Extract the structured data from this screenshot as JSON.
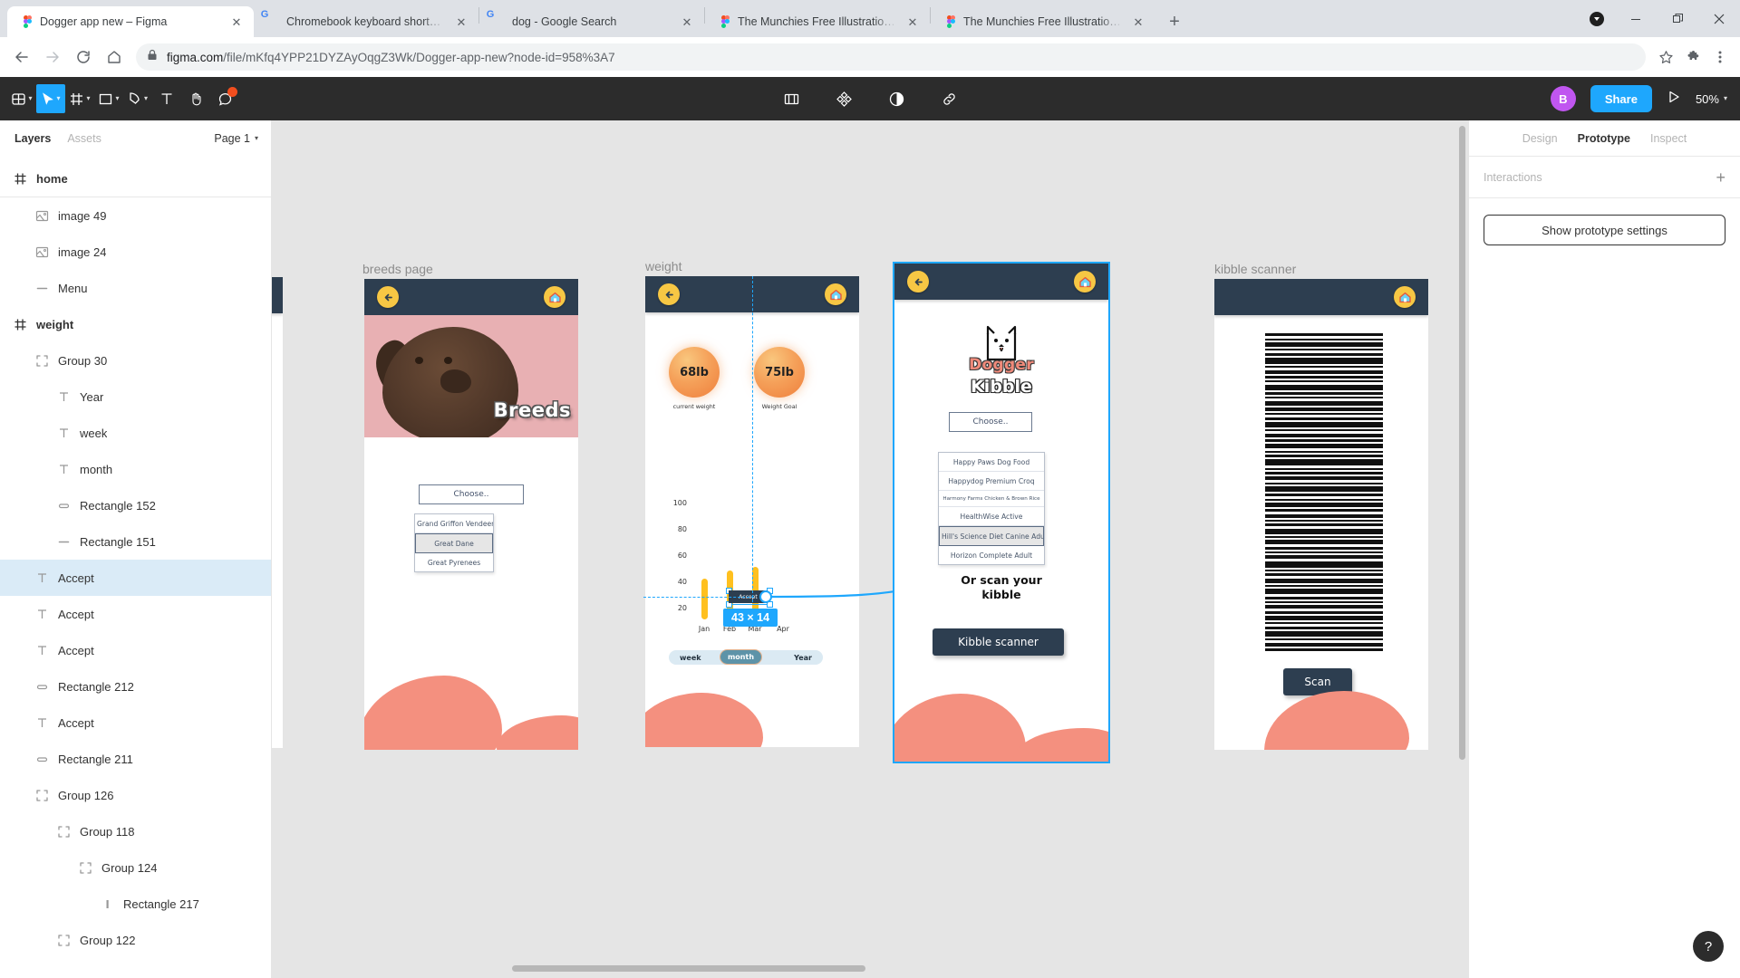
{
  "browser": {
    "tabs": [
      {
        "title": "Dogger app new – Figma",
        "favicon": "figma-icon",
        "active": true
      },
      {
        "title": "Chromebook keyboard shortcuts",
        "favicon": "google-icon",
        "active": false
      },
      {
        "title": "dog - Google Search",
        "favicon": "google-icon",
        "active": false
      },
      {
        "title": "The Munchies Free Illustrations -",
        "favicon": "figma-icon",
        "active": false
      },
      {
        "title": "The Munchies Free Illustrations (",
        "favicon": "figma-icon",
        "active": false
      }
    ],
    "new_tab_label": "+",
    "close_label": "✕",
    "window_controls": {
      "minimize": "—",
      "maximize": "❐",
      "close": "✕"
    },
    "url": {
      "host": "figma.com",
      "path": "/file/mKfq4YPP21DYZAyOqgZ3Wk/Dogger-app-new?node-id=958%3A7",
      "lock_icon": "lock-icon"
    },
    "omni_icons": {
      "back": "back-arrow-icon",
      "forward": "forward-arrow-icon",
      "reload": "reload-icon",
      "home": "home-icon",
      "bookmark": "star-icon",
      "extensions": "puzzle-piece-icon",
      "menu": "three-dot-menu-icon",
      "profile": "profile-avatar-icon"
    }
  },
  "figma_toolbar": {
    "left_tools": [
      {
        "name": "main-menu",
        "icon": "figma-logo-icon",
        "has_caret": true,
        "active": false
      },
      {
        "name": "move-tool",
        "icon": "cursor-arrow-icon",
        "has_caret": true,
        "active": true
      },
      {
        "name": "frame-tool",
        "icon": "frame-icon",
        "has_caret": true,
        "active": false
      },
      {
        "name": "shape-tool",
        "icon": "rectangle-icon",
        "has_caret": true,
        "active": false
      },
      {
        "name": "pen-tool",
        "icon": "pen-icon",
        "has_caret": true,
        "active": false
      },
      {
        "name": "text-tool",
        "icon": "text-t-icon",
        "has_caret": false,
        "active": false
      },
      {
        "name": "hand-tool",
        "icon": "hand-icon",
        "has_caret": false,
        "active": false
      },
      {
        "name": "comment-tool",
        "icon": "comment-bubble-icon",
        "has_caret": false,
        "active": false
      }
    ],
    "center_tools": [
      {
        "name": "components",
        "icon": "component-icon"
      },
      {
        "name": "plugins",
        "icon": "plugin-grid-icon"
      },
      {
        "name": "contrast",
        "icon": "contrast-circle-icon"
      },
      {
        "name": "link",
        "icon": "link-chain-icon"
      }
    ],
    "avatar_initial": "B",
    "share_label": "Share",
    "present_icon": "play-triangle-icon",
    "zoom_level": "50%",
    "zoom_caret": "▾"
  },
  "left_panel": {
    "tabs": [
      {
        "label": "Layers",
        "active": true
      },
      {
        "label": "Assets",
        "active": false
      }
    ],
    "page_selector": "Page 1",
    "page_caret": "▾",
    "layers": [
      {
        "name": "home",
        "icon": "frame-hash-icon",
        "indent": 0,
        "bold": true,
        "selected": false
      },
      {
        "name": "image 49",
        "icon": "image-icon",
        "indent": 1,
        "bold": false,
        "selected": false
      },
      {
        "name": "image 24",
        "icon": "image-icon",
        "indent": 1,
        "bold": false,
        "selected": false
      },
      {
        "name": "Menu",
        "icon": "line-icon",
        "indent": 1,
        "bold": false,
        "selected": false
      },
      {
        "name": "weight",
        "icon": "frame-hash-icon",
        "indent": 0,
        "bold": true,
        "selected": false
      },
      {
        "name": "Group 30",
        "icon": "group-icon",
        "indent": 1,
        "bold": false,
        "selected": false
      },
      {
        "name": "Year",
        "icon": "text-layer-icon",
        "indent": 2,
        "bold": false,
        "selected": false
      },
      {
        "name": "week",
        "icon": "text-layer-icon",
        "indent": 2,
        "bold": false,
        "selected": false
      },
      {
        "name": "month",
        "icon": "text-layer-icon",
        "indent": 2,
        "bold": false,
        "selected": false
      },
      {
        "name": "Rectangle 152",
        "icon": "rounded-rect-icon",
        "indent": 2,
        "bold": false,
        "selected": false
      },
      {
        "name": "Rectangle 151",
        "icon": "line-icon",
        "indent": 2,
        "bold": false,
        "selected": false
      },
      {
        "name": "Accept",
        "icon": "text-layer-icon",
        "indent": 1,
        "bold": false,
        "selected": true
      },
      {
        "name": "Accept",
        "icon": "text-layer-icon",
        "indent": 1,
        "bold": false,
        "selected": false
      },
      {
        "name": "Accept",
        "icon": "text-layer-icon",
        "indent": 1,
        "bold": false,
        "selected": false
      },
      {
        "name": "Rectangle 212",
        "icon": "rounded-rect-icon",
        "indent": 1,
        "bold": false,
        "selected": false
      },
      {
        "name": "Accept",
        "icon": "text-layer-icon",
        "indent": 1,
        "bold": false,
        "selected": false
      },
      {
        "name": "Rectangle 211",
        "icon": "rounded-rect-icon",
        "indent": 1,
        "bold": false,
        "selected": false
      },
      {
        "name": "Group 126",
        "icon": "group-icon",
        "indent": 1,
        "bold": false,
        "selected": false
      },
      {
        "name": "Group 118",
        "icon": "group-icon",
        "indent": 2,
        "bold": false,
        "selected": false
      },
      {
        "name": "Group 124",
        "icon": "group-icon",
        "indent": 3,
        "bold": false,
        "selected": false
      },
      {
        "name": "Rectangle 217",
        "icon": "vbar-icon",
        "indent": 4,
        "bold": false,
        "selected": false
      },
      {
        "name": "Group 122",
        "icon": "group-icon",
        "indent": 2,
        "bold": false,
        "selected": false
      }
    ]
  },
  "right_panel": {
    "tabs": [
      {
        "label": "Design",
        "active": false
      },
      {
        "label": "Prototype",
        "active": true
      },
      {
        "label": "Inspect",
        "active": false
      }
    ],
    "interactions_label": "Interactions",
    "add_interaction_icon": "plus-icon",
    "show_prototype_settings_label": "Show prototype settings",
    "help_label": "?"
  },
  "canvas": {
    "selection_size_badge": "43 × 14",
    "back_hotspot_icon": "back-flow-arrow-icon",
    "frames": [
      {
        "id": "breeds-page",
        "label": "breeds page",
        "topbar": {
          "back_icon": "back-arrow-circle-icon",
          "home_icon": "home-circle-icon"
        },
        "hero_caption": "Breeds",
        "choose_label": "Choose..",
        "options": [
          {
            "label": "Grand Griffon Vendeen",
            "selected": false
          },
          {
            "label": "Great Dane",
            "selected": true
          },
          {
            "label": "Great Pyrenees",
            "selected": false
          }
        ]
      },
      {
        "id": "weight",
        "label": "weight",
        "topbar": {
          "back_icon": "back-arrow-circle-icon",
          "home_icon": "home-circle-icon"
        },
        "metrics": [
          {
            "value": "68lb",
            "caption": "current weight"
          },
          {
            "value": "75lb",
            "caption": "Weight Goal"
          }
        ],
        "segments": [
          {
            "label": "week",
            "active": false
          },
          {
            "label": "month",
            "active": true
          },
          {
            "label": "Year",
            "active": false
          }
        ]
      },
      {
        "id": "kibble",
        "label": "",
        "topbar": {
          "back_icon": "back-arrow-circle-icon",
          "home_icon": "home-circle-icon"
        },
        "logo_word": "Dogger",
        "logo_sub": "Kibble",
        "choose_label": "Choose..",
        "options": [
          {
            "label": "Happy Paws Dog Food",
            "selected": false,
            "tiny": false
          },
          {
            "label": "Happydog Premium Croq",
            "selected": false,
            "tiny": false
          },
          {
            "label": "Harmony Farms Chicken & Brown Rice",
            "selected": false,
            "tiny": true
          },
          {
            "label": "HealthWise Active",
            "selected": false,
            "tiny": false
          },
          {
            "label": "Hill's Science Diet Canine Adult",
            "selected": true,
            "tiny": false
          },
          {
            "label": "Horizon Complete Adult",
            "selected": false,
            "tiny": false
          }
        ],
        "scan_heading_line1": "Or scan your",
        "scan_heading_line2": "kibble",
        "scanner_button": "Kibble scanner"
      },
      {
        "id": "kibble-scanner",
        "label": "kibble scanner",
        "topbar": {
          "home_icon": "home-circle-icon"
        },
        "scan_button": "Scan"
      }
    ],
    "chart_data": {
      "type": "bar",
      "title": "weight",
      "categories": [
        "Jan",
        "Feb",
        "Mar",
        "Apr"
      ],
      "values": [
        45,
        52,
        55,
        0
      ],
      "yticks": [
        20,
        40,
        60,
        80,
        100
      ],
      "ylim": [
        0,
        110
      ],
      "xlabel": "",
      "ylabel": "",
      "grid": false,
      "legend": "none",
      "series_color": "#ffc01f"
    }
  },
  "colors": {
    "figma_blue": "#1ea7fd",
    "toolbar_dark": "#2c2c2c",
    "app_navy": "#2d3e50",
    "app_yellow": "#f7c744",
    "app_coral": "#f4907f",
    "bar_yellow": "#ffc01f",
    "canvas_bg": "#e5e5e5",
    "selection_blue": "#daebf7"
  }
}
